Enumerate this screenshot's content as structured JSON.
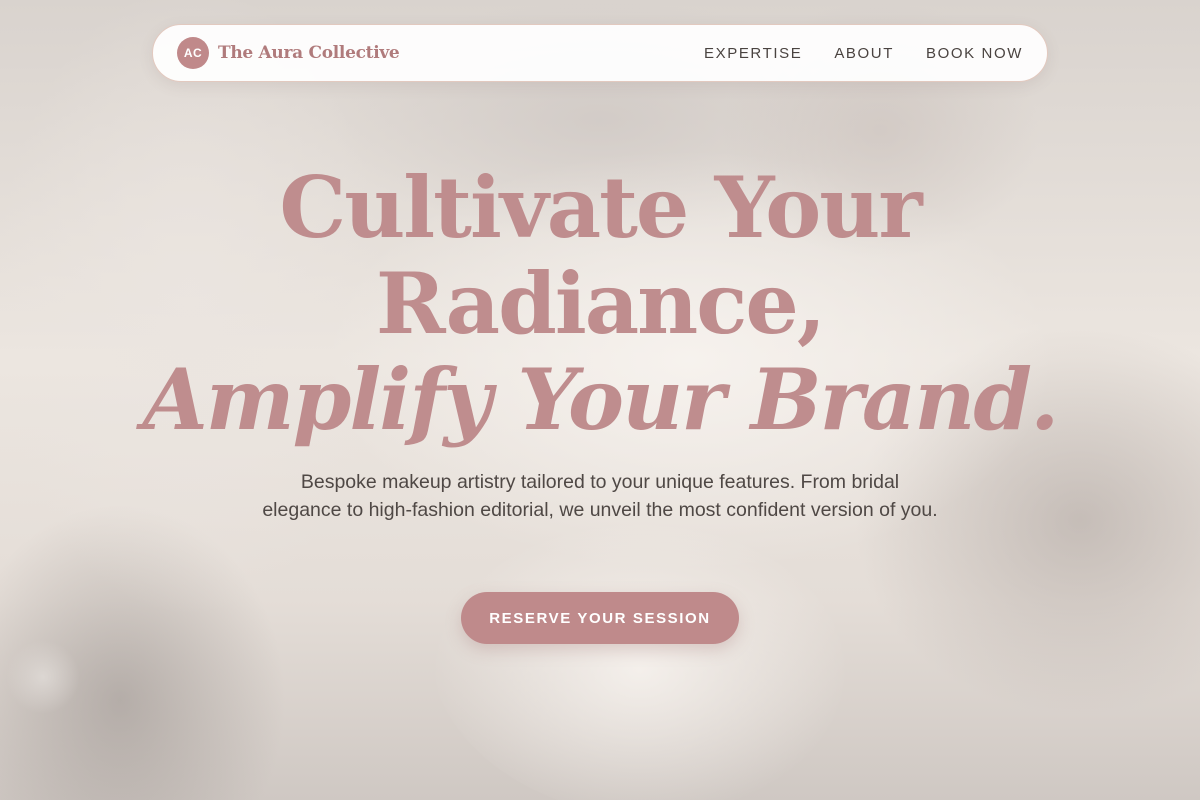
{
  "brand": {
    "badge": "AC",
    "name": "The Aura Collective"
  },
  "nav": {
    "items": [
      {
        "label": "EXPERTISE"
      },
      {
        "label": "ABOUT"
      },
      {
        "label": "BOOK NOW"
      }
    ]
  },
  "hero": {
    "headline_line1": "Cultivate Your",
    "headline_line2": "Radiance,",
    "headline_line3": "Amplify Your Brand.",
    "subtitle": "Bespoke makeup artistry tailored to your unique features. From bridal elegance to high-fashion editorial, we unveil the most confident version of you.",
    "cta_label": "RESERVE YOUR SESSION"
  },
  "colors": {
    "accent": "#bf8a8b",
    "brand_text": "#b07b7c",
    "nav_text": "#4a4340",
    "body_text": "#4f4845"
  }
}
